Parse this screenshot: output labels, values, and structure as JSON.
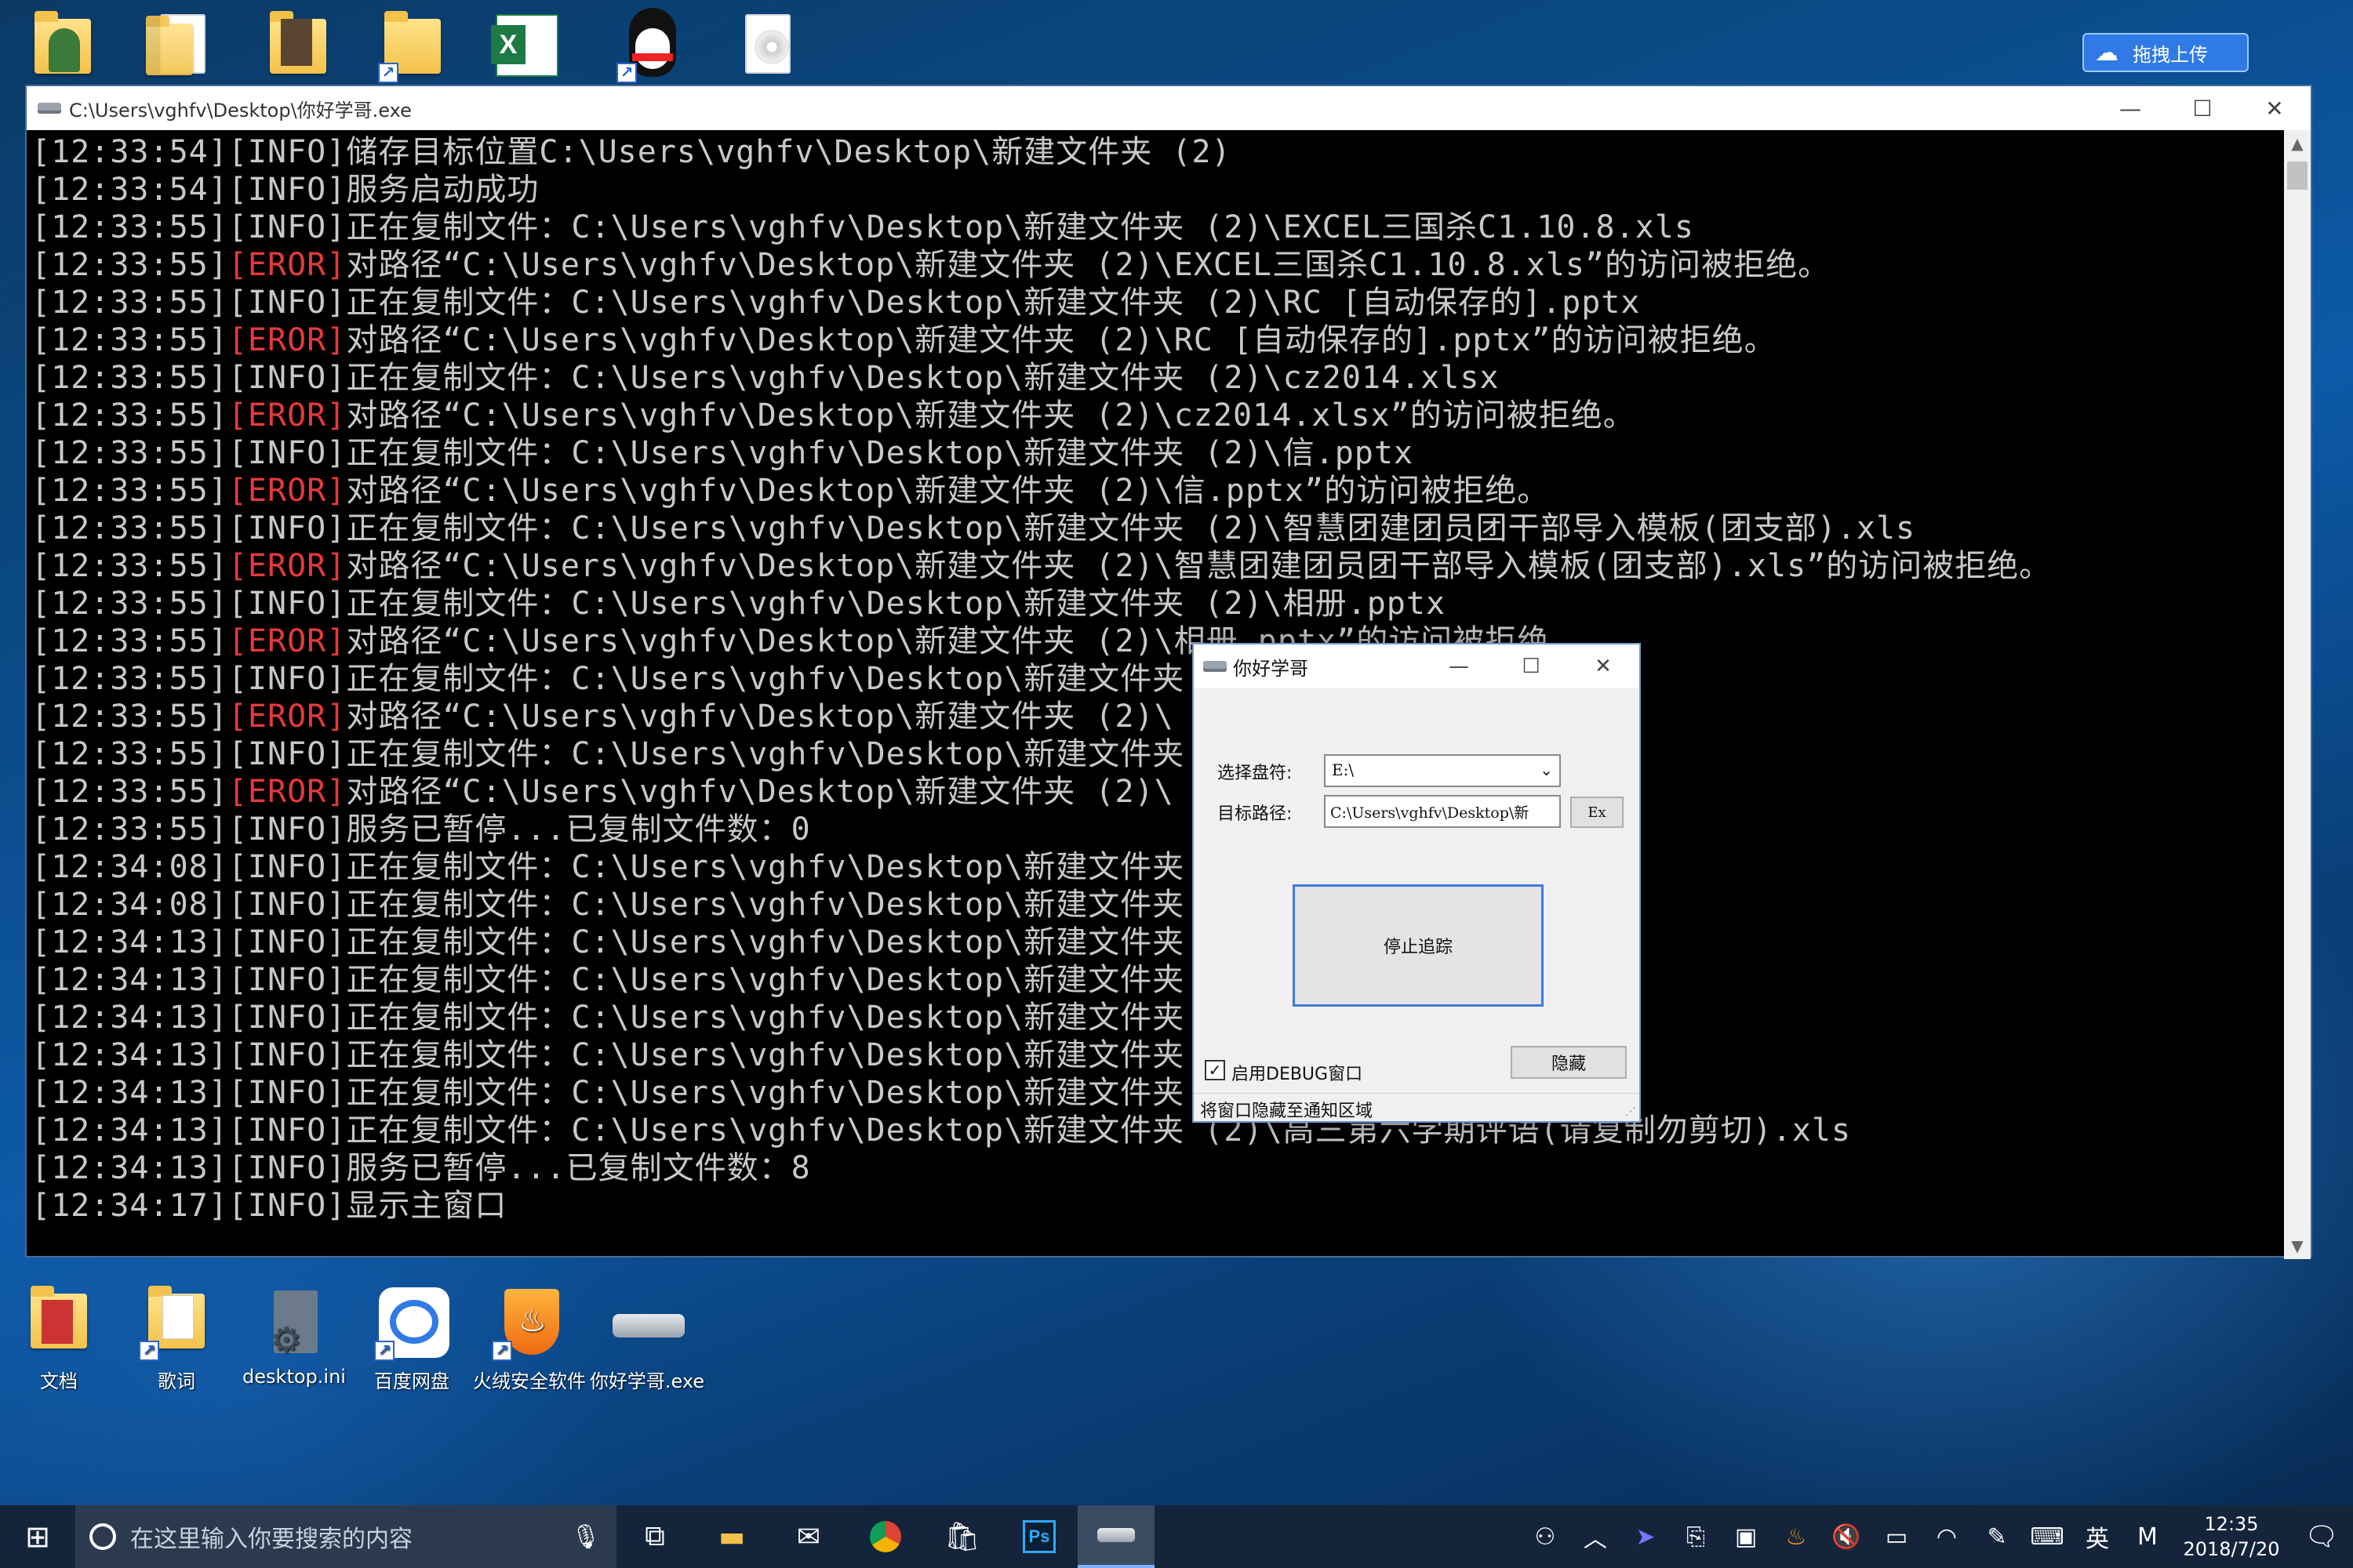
{
  "desktop": {
    "top_icons": [
      "user-folder",
      "document",
      "photo-folder",
      "folder-shortcut",
      "excel",
      "qq-shortcut",
      "disc-file"
    ],
    "upload_button": "拖拽上传",
    "bottom_icons": [
      {
        "label": "文档",
        "icon": "documents-folder-icon"
      },
      {
        "label": "歌词",
        "icon": "lyrics-folder-icon"
      },
      {
        "label": "desktop.ini",
        "icon": "settings-file-icon"
      },
      {
        "label": "百度网盘",
        "icon": "baidu-netdisk-icon"
      },
      {
        "label": "火绒安全软件",
        "icon": "huorong-icon"
      },
      {
        "label": "你好学哥.exe",
        "icon": "exe-drive-icon"
      }
    ]
  },
  "console": {
    "title": "C:\\Users\\vghfv\\Desktop\\你好学哥.exe",
    "lines": [
      {
        "time": "[12:33:54]",
        "level": "[INFO]",
        "msg": "储存目标位置C:\\Users\\vghfv\\Desktop\\新建文件夹 (2)"
      },
      {
        "time": "[12:33:54]",
        "level": "[INFO]",
        "msg": "服务启动成功"
      },
      {
        "time": "[12:33:55]",
        "level": "[INFO]",
        "msg": "正在复制文件：C:\\Users\\vghfv\\Desktop\\新建文件夹 (2)\\EXCEL三国杀C1.10.8.xls"
      },
      {
        "time": "[12:33:55]",
        "level": "[EROR]",
        "msg": "对路径“C:\\Users\\vghfv\\Desktop\\新建文件夹 (2)\\EXCEL三国杀C1.10.8.xls”的访问被拒绝。"
      },
      {
        "time": "[12:33:55]",
        "level": "[INFO]",
        "msg": "正在复制文件：C:\\Users\\vghfv\\Desktop\\新建文件夹 (2)\\RC [自动保存的].pptx"
      },
      {
        "time": "[12:33:55]",
        "level": "[EROR]",
        "msg": "对路径“C:\\Users\\vghfv\\Desktop\\新建文件夹 (2)\\RC [自动保存的].pptx”的访问被拒绝。"
      },
      {
        "time": "[12:33:55]",
        "level": "[INFO]",
        "msg": "正在复制文件：C:\\Users\\vghfv\\Desktop\\新建文件夹 (2)\\cz2014.xlsx"
      },
      {
        "time": "[12:33:55]",
        "level": "[EROR]",
        "msg": "对路径“C:\\Users\\vghfv\\Desktop\\新建文件夹 (2)\\cz2014.xlsx”的访问被拒绝。"
      },
      {
        "time": "[12:33:55]",
        "level": "[INFO]",
        "msg": "正在复制文件：C:\\Users\\vghfv\\Desktop\\新建文件夹 (2)\\信.pptx"
      },
      {
        "time": "[12:33:55]",
        "level": "[EROR]",
        "msg": "对路径“C:\\Users\\vghfv\\Desktop\\新建文件夹 (2)\\信.pptx”的访问被拒绝。"
      },
      {
        "time": "[12:33:55]",
        "level": "[INFO]",
        "msg": "正在复制文件：C:\\Users\\vghfv\\Desktop\\新建文件夹 (2)\\智慧团建团员团干部导入模板(团支部).xls"
      },
      {
        "time": "[12:33:55]",
        "level": "[EROR]",
        "msg": "对路径“C:\\Users\\vghfv\\Desktop\\新建文件夹 (2)\\智慧团建团员团干部导入模板(团支部).xls”的访问被拒绝。"
      },
      {
        "time": "[12:33:55]",
        "level": "[INFO]",
        "msg": "正在复制文件：C:\\Users\\vghfv\\Desktop\\新建文件夹 (2)\\相册.pptx"
      },
      {
        "time": "[12:33:55]",
        "level": "[EROR]",
        "msg": "对路径“C:\\Users\\vghfv\\Desktop\\新建文件夹 (2)\\相册.pptx”的访问被拒绝。"
      },
      {
        "time": "[12:33:55]",
        "level": "[INFO]",
        "msg": "正在复制文件：C:\\Users\\vghfv\\Desktop\\新建文件夹 到来.pptx"
      },
      {
        "time": "[12:33:55]",
        "level": "[EROR]",
        "msg": "对路径“C:\\Users\\vghfv\\Desktop\\新建文件夹 (2)\\ ptx”的访问被拒绝。"
      },
      {
        "time": "[12:33:55]",
        "level": "[INFO]",
        "msg": "正在复制文件：C:\\Users\\vghfv\\Desktop\\新建文件夹 请复制勿剪切).xls"
      },
      {
        "time": "[12:33:55]",
        "level": "[EROR]",
        "msg": "对路径“C:\\Users\\vghfv\\Desktop\\新建文件夹 (2)\\ 勿剪切).xls”的访问被拒绝。"
      },
      {
        "time": "[12:33:55]",
        "level": "[INFO]",
        "msg": "服务已暂停...已复制文件数：0"
      },
      {
        "time": "[12:34:08]",
        "level": "[INFO]",
        "msg": "正在复制文件：C:\\Users\\vghfv\\Desktop\\新建文件夹 .xls"
      },
      {
        "time": "[12:34:08]",
        "level": "[INFO]",
        "msg": "正在复制文件：C:\\Users\\vghfv\\Desktop\\新建文件夹 tx"
      },
      {
        "time": "[12:34:13]",
        "level": "[INFO]",
        "msg": "正在复制文件：C:\\Users\\vghfv\\Desktop\\新建文件夹"
      },
      {
        "time": "[12:34:13]",
        "level": "[INFO]",
        "msg": "正在复制文件：C:\\Users\\vghfv\\Desktop\\新建文件夹"
      },
      {
        "time": "[12:34:13]",
        "level": "[INFO]",
        "msg": "正在复制文件：C:\\Users\\vghfv\\Desktop\\新建文件夹 导入模板(团支部).xls"
      },
      {
        "time": "[12:34:13]",
        "level": "[INFO]",
        "msg": "正在复制文件：C:\\Users\\vghfv\\Desktop\\新建文件夹"
      },
      {
        "time": "[12:34:13]",
        "level": "[INFO]",
        "msg": "正在复制文件：C:\\Users\\vghfv\\Desktop\\新建文件夹 到来.pptx"
      },
      {
        "time": "[12:34:13]",
        "level": "[INFO]",
        "msg": "正在复制文件：C:\\Users\\vghfv\\Desktop\\新建文件夹 (2)\\高三第六学期评语(请复制勿剪切).xls"
      },
      {
        "time": "[12:34:13]",
        "level": "[INFO]",
        "msg": "服务已暂停...已复制文件数：8"
      },
      {
        "time": "[12:34:17]",
        "level": "[INFO]",
        "msg": "显示主窗口"
      }
    ]
  },
  "dialog": {
    "title": "你好学哥",
    "drive_label": "选择盘符:",
    "drive_value": "E:\\",
    "target_label": "目标路径:",
    "target_value": "C:\\Users\\vghfv\\Desktop\\新",
    "ex_button": "Ex",
    "stop_button": "停止追踪",
    "hide_button": "隐藏",
    "debug_checkbox_label": "启用DEBUG窗口",
    "debug_checked": true,
    "status_text": "将窗口隐藏至通知区域"
  },
  "taskbar": {
    "search_placeholder": "在这里输入你要搜索的内容",
    "ime_label": "英",
    "ime_mode": "M",
    "time": "12:35",
    "date": "2018/7/20"
  },
  "colors": {
    "error": "#e43a3a",
    "info": "#c8c8c8",
    "accent": "#3d7bd9"
  }
}
